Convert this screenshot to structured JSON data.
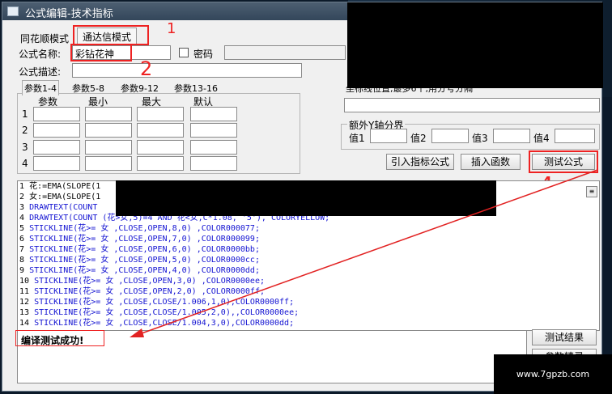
{
  "window": {
    "title": "公式编辑-技术指标"
  },
  "mode_tabs": [
    {
      "label": "同花顺模式"
    },
    {
      "label": "通达信模式"
    }
  ],
  "annotations": {
    "n1": "1",
    "n2": "2",
    "n4": "4"
  },
  "form": {
    "name_label": "公式名称:",
    "name_value": "彩钻花神",
    "password_label": "密码",
    "desc_label": "公式描述:"
  },
  "param_tabs": [
    {
      "label": "参数1-4"
    },
    {
      "label": "参数5-8"
    },
    {
      "label": "参数9-12"
    },
    {
      "label": "参数13-16"
    }
  ],
  "param_headers": [
    "参数",
    "最小",
    "最大",
    "默认"
  ],
  "param_rows": [
    "1",
    "2",
    "3",
    "4"
  ],
  "axis_label": "坐标线位置,最多6个,用分号分隔",
  "y_axis": {
    "group_label": "额外Y轴分界",
    "v1": "值1",
    "v2": "值2",
    "v3": "值3",
    "v4": "值4"
  },
  "buttons": {
    "import": "引入指标公式",
    "insert": "插入函数",
    "test": "测试公式",
    "test_result": "测试结果",
    "param_guide": "参数精灵"
  },
  "code_lines": [
    {
      "n": "1",
      "t": "花:=EMA(SLOPE(1"
    },
    {
      "n": "2",
      "t": "女:=EMA(SLOPE(1"
    },
    {
      "n": "3",
      "t": "DRAWTEXT(COUNT"
    },
    {
      "n": "4",
      "t": "DRAWTEXT(COUNT (花>女,5)=4 AND 花<女,C*1.08, '5'), COLORYELLOW;"
    },
    {
      "n": "5",
      "t": "STICKLINE(花>= 女 ,CLOSE,OPEN,8,0) ,COLOR000077;"
    },
    {
      "n": "6",
      "t": "STICKLINE(花>= 女 ,CLOSE,OPEN,7,0) ,COLOR000099;"
    },
    {
      "n": "7",
      "t": "STICKLINE(花>= 女 ,CLOSE,OPEN,6,0) ,COLOR0000bb;"
    },
    {
      "n": "8",
      "t": "STICKLINE(花>= 女 ,CLOSE,OPEN,5,0) ,COLOR0000cc;"
    },
    {
      "n": "9",
      "t": "STICKLINE(花>= 女 ,CLOSE,OPEN,4,0) ,COLOR0000dd;"
    },
    {
      "n": "10",
      "t": "STICKLINE(花>= 女 ,CLOSE,OPEN,3,0) ,COLOR0000ee;"
    },
    {
      "n": "11",
      "t": "STICKLINE(花>= 女 ,CLOSE,OPEN,2,0) ,COLOR0000ff;"
    },
    {
      "n": "12",
      "t": "STICKLINE(花>= 女 ,CLOSE,CLOSE/1.006,1,0),COLOR0000ff;"
    },
    {
      "n": "13",
      "t": "STICKLINE(花>= 女 ,CLOSE,CLOSE/1.005,2,0),,COLOR0000ee;"
    },
    {
      "n": "14",
      "t": "STICKLINE(花>= 女 ,CLOSE,CLOSE/1.004,3,0),COLOR0000dd;"
    }
  ],
  "output_text": "编译测试成功!",
  "watermark": "www.7gpzb.com",
  "colors": {
    "annotation": "#e22222",
    "keyword": "#1414d2",
    "number": "#a800a8"
  }
}
